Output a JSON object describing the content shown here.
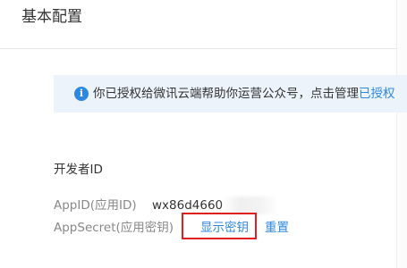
{
  "header": {
    "title": "基本配置"
  },
  "notice": {
    "icon": "info-icon",
    "icon_glyph": "i",
    "text": "你已授权给微讯云端帮助你运营公众号，点击管理",
    "link_label": "已授权"
  },
  "developer": {
    "section_title": "开发者ID",
    "appid_label": "AppID(应用ID)",
    "appid_value": "wx86d4660",
    "appsecret_label": "AppSecret(应用密钥)",
    "show_key_label": "显示密钥",
    "reset_label": "重置"
  },
  "colors": {
    "accent": "#2f88e0",
    "highlight_border": "#e02020",
    "notice_bg": "#edf3fa"
  }
}
